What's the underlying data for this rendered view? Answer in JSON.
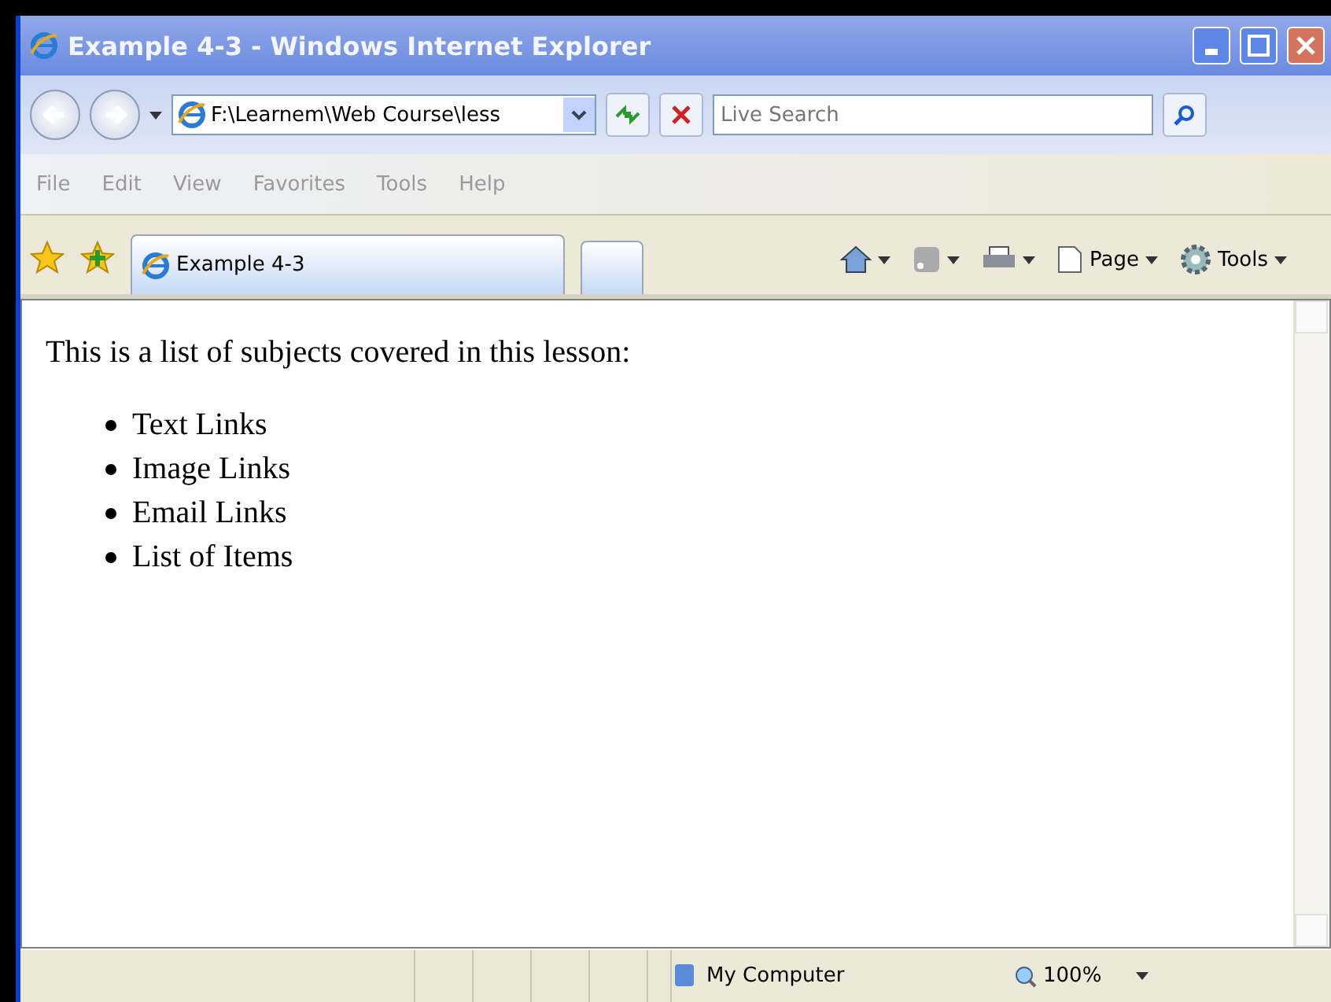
{
  "window": {
    "title": "Example 4-3 - Windows Internet Explorer"
  },
  "address_bar": {
    "value": "F:\\Learnem\\Web Course\\less"
  },
  "search": {
    "placeholder": "Live Search"
  },
  "menu": [
    "File",
    "Edit",
    "View",
    "Favorites",
    "Tools",
    "Help"
  ],
  "tabs": [
    {
      "label": "Example 4-3",
      "selected": true
    }
  ],
  "command_bar": [
    {
      "kind": "home"
    },
    {
      "kind": "feeds"
    },
    {
      "kind": "print"
    },
    {
      "kind": "page",
      "label": "Page"
    },
    {
      "kind": "tools",
      "label": "Tools"
    }
  ],
  "page": {
    "intro": "This is a list of subjects covered in this lesson:",
    "items": [
      "Text Links",
      "Image Links",
      "Email Links",
      "List of Items"
    ]
  },
  "status_bar": {
    "zone": "My Computer",
    "zoom": "100%"
  }
}
